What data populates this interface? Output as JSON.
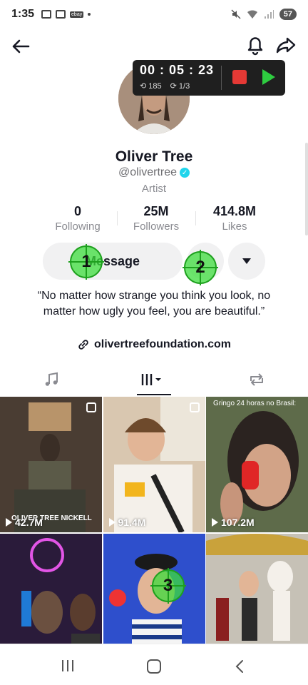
{
  "status_bar": {
    "time": "1:35",
    "battery": "57"
  },
  "recorder": {
    "timer": "00 : 05 : 23",
    "count_a": "185",
    "count_b": "1/3"
  },
  "profile": {
    "name": "Oliver Tree",
    "handle": "@olivertree",
    "category": "Artist",
    "stats": [
      {
        "value": "0",
        "label": "Following"
      },
      {
        "value": "25M",
        "label": "Followers"
      },
      {
        "value": "414.8M",
        "label": "Likes"
      }
    ],
    "message_label": "Message",
    "bio": "“No matter how strange you think you look, no matter how ugly you feel, you are beautiful.”",
    "link": "olivertreefoundation.com"
  },
  "markers": [
    "1",
    "2",
    "3"
  ],
  "videos": [
    {
      "views": "42.7M",
      "banner": "OLIVER TREE NICKELL"
    },
    {
      "views": "91.4M"
    },
    {
      "views": "107.2M",
      "caption": "Gringo 24 horas no Brasil:"
    },
    {
      "views": ""
    },
    {
      "views": ""
    },
    {
      "views": ""
    }
  ],
  "colors": {
    "accent_green": "#2ecc40",
    "stop_red": "#e53935",
    "verified": "#20d5ec"
  }
}
